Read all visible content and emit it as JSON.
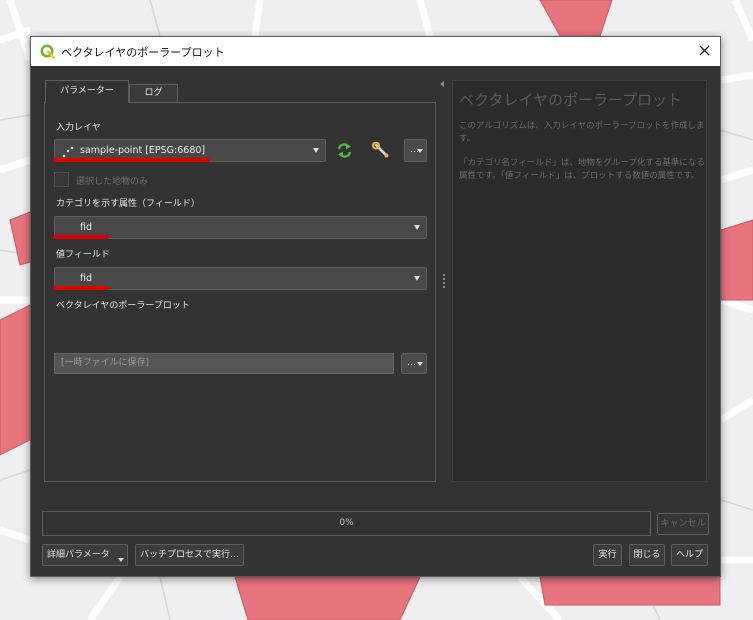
{
  "colors": {
    "dialog_bg": "#333333",
    "field_bg": "#484848",
    "accent_red": "#e00000",
    "map_polygon": "#e8747d",
    "refresh_icon": "#4fbf3f"
  },
  "dialog": {
    "title": "ベクタレイヤのポーラープロット",
    "tabs": [
      "パラメーター",
      "ログ"
    ],
    "params": {
      "input_layer_label": "入力レイヤ",
      "input_layer_value": "sample-point [EPSG:6680]",
      "selected_only_label": "選択した地物のみ",
      "category_field_label": "カテゴリを示す属性（フィールド）",
      "category_field_value": "fid",
      "value_field_label": "値フィールド",
      "value_field_value": "fid",
      "output_label": "ベクタレイヤのポーラープロット",
      "output_value": "[一時ファイルに保存]",
      "browse_label": "…"
    },
    "help": {
      "title": "ベクタレイヤのポーラープロット",
      "paragraph1": "このアルゴリズムは、入力レイヤのポーラープロットを作成します。",
      "paragraph2": "「カテゴリ名フィールド」は、地物をグループ化する基準になる属性です。「値フィールド」は、プロットする数値の属性です。"
    },
    "progress": {
      "text": "0%",
      "value": 0
    },
    "buttons": {
      "cancel": "キャンセル",
      "advanced": "詳細パラメータ",
      "batch": "バッチプロセスで実行…",
      "run": "実行",
      "close": "閉じる",
      "help": "ヘルプ"
    },
    "icons": {
      "logo": "qgis-logo-icon",
      "close": "close-icon",
      "refresh": "refresh-icon",
      "settings": "wrench-icon",
      "point_layer": "point-layer-icon"
    }
  }
}
